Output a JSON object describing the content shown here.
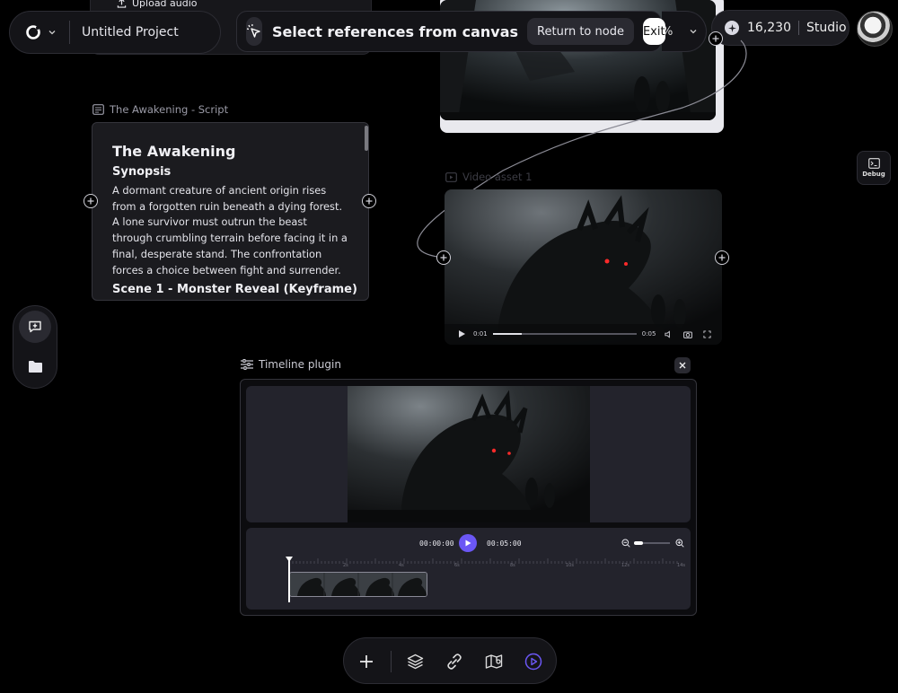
{
  "header": {
    "project_title": "Untitled Project",
    "upload_audio_label": "Upload audio",
    "select_refs_label": "Select references from canvas",
    "return_label": "Return to node",
    "exit_label": "Exit",
    "zoom_fragment": "%",
    "credits": "16,230",
    "plan": "Studio"
  },
  "script_node": {
    "label": "The Awakening - Script",
    "title": "The Awakening",
    "synopsis_heading": "Synopsis",
    "synopsis": "A dormant creature of ancient origin rises from a forgotten ruin beneath a dying forest. A lone survivor must outrun the beast through crumbling terrain before facing it in a final, desperate stand. The confrontation forces a choice between fight and surrender.",
    "scene_heading": "Scene 1 - Monster Reveal (Keyframe)"
  },
  "video_node": {
    "label": "Video asset 1",
    "time_current": "0:01",
    "time_total": "0:05",
    "progress": 0.2
  },
  "debug": {
    "label": "Debug"
  },
  "timeline": {
    "label": "Timeline plugin",
    "time_current": "00:00:00",
    "time_total": "00:05:00",
    "zoom_level": 0.25,
    "ticks": [
      "0s",
      "2s",
      "4s",
      "6s",
      "8s",
      "10s",
      "12s",
      "14s"
    ]
  },
  "colors": {
    "accent": "#6b57f5",
    "background": "#000000",
    "panel": "#141418"
  }
}
